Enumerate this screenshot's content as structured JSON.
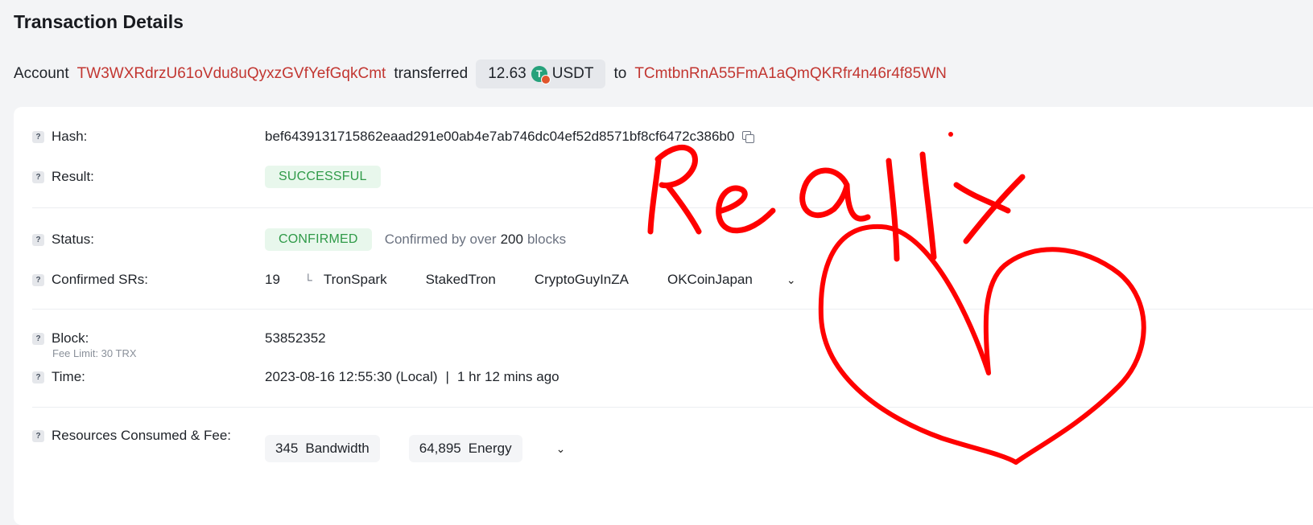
{
  "page": {
    "title": "Transaction Details"
  },
  "summary": {
    "account_word": "Account",
    "from_address": "TW3WXRdrzU61oVdu8uQyxzGVfYefGqkCmt",
    "transferred_word": "transferred",
    "amount": "12.63",
    "token_symbol": "USDT",
    "token_icon": "tether-token-icon",
    "to_word": "to",
    "to_address": "TCmtbnRnA55FmA1aQmQKRfr4n46r4f85WN"
  },
  "details": {
    "hash": {
      "label": "Hash:",
      "value": "bef6439131715862eaad291e00ab4e7ab746dc04ef52d8571bf8cf6472c386b0"
    },
    "result": {
      "label": "Result:",
      "value": "SUCCESSFUL"
    },
    "status": {
      "label": "Status:",
      "value": "CONFIRMED",
      "note_prefix": "Confirmed by over",
      "note_count": "200",
      "note_suffix": "blocks"
    },
    "confirmed_srs": {
      "label": "Confirmed SRs:",
      "count": "19",
      "items": [
        "TronSpark",
        "StakedTron",
        "CryptoGuyInZA",
        "OKCoinJapan"
      ]
    },
    "block": {
      "label": "Block:",
      "value": "53852352"
    },
    "time": {
      "label": "Time:",
      "value": "2023-08-16 12:55:30 (Local)",
      "separator": "|",
      "relative": "1 hr 12 mins ago"
    },
    "resources": {
      "label": "Resources Consumed & Fee:",
      "fee_limit": "Fee Limit: 30 TRX",
      "bandwidth_value": "345",
      "bandwidth_label": "Bandwidth",
      "energy_value": "64,895",
      "energy_label": "Energy"
    }
  },
  "overlay": {
    "handwritten_text": "Realix",
    "drawing": "heart",
    "ink_color": "#ff0000"
  },
  "colors": {
    "link_red": "#c23631",
    "success_green": "#2f9a48",
    "success_bg": "#e8f7ec"
  }
}
